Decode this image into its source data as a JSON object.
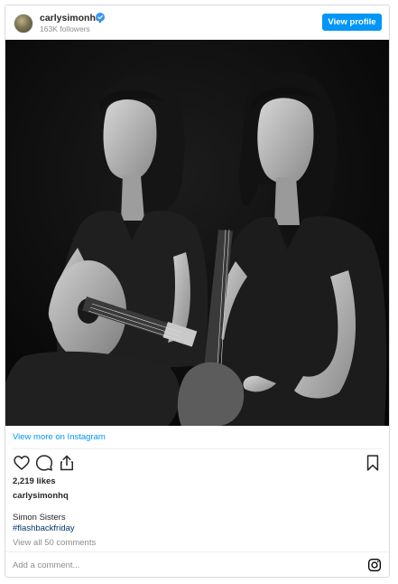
{
  "header": {
    "username": "carlysimonhq",
    "verified_icon": "verified-badge-icon",
    "followers": "163K followers",
    "view_profile_label": "View profile"
  },
  "post": {
    "image_icon": "black-and-white-photo",
    "view_more_label": "View more on Instagram",
    "actions": {
      "like_icon": "heart-icon",
      "comment_icon": "comment-icon",
      "share_icon": "share-icon",
      "save_icon": "bookmark-icon"
    },
    "likes": "2,219 likes",
    "author": "carlysimonhq",
    "caption": "Simon Sisters",
    "hashtag": "#flashbackfriday",
    "view_all_comments": "View all 50 comments"
  },
  "comment_bar": {
    "placeholder": "Add a comment...",
    "instagram_icon": "instagram-logo-icon"
  },
  "colors": {
    "accent": "#0095f6",
    "hashtag": "#00376b",
    "muted": "#8e8e8e",
    "text": "#262626",
    "border": "#dbdbdb"
  }
}
